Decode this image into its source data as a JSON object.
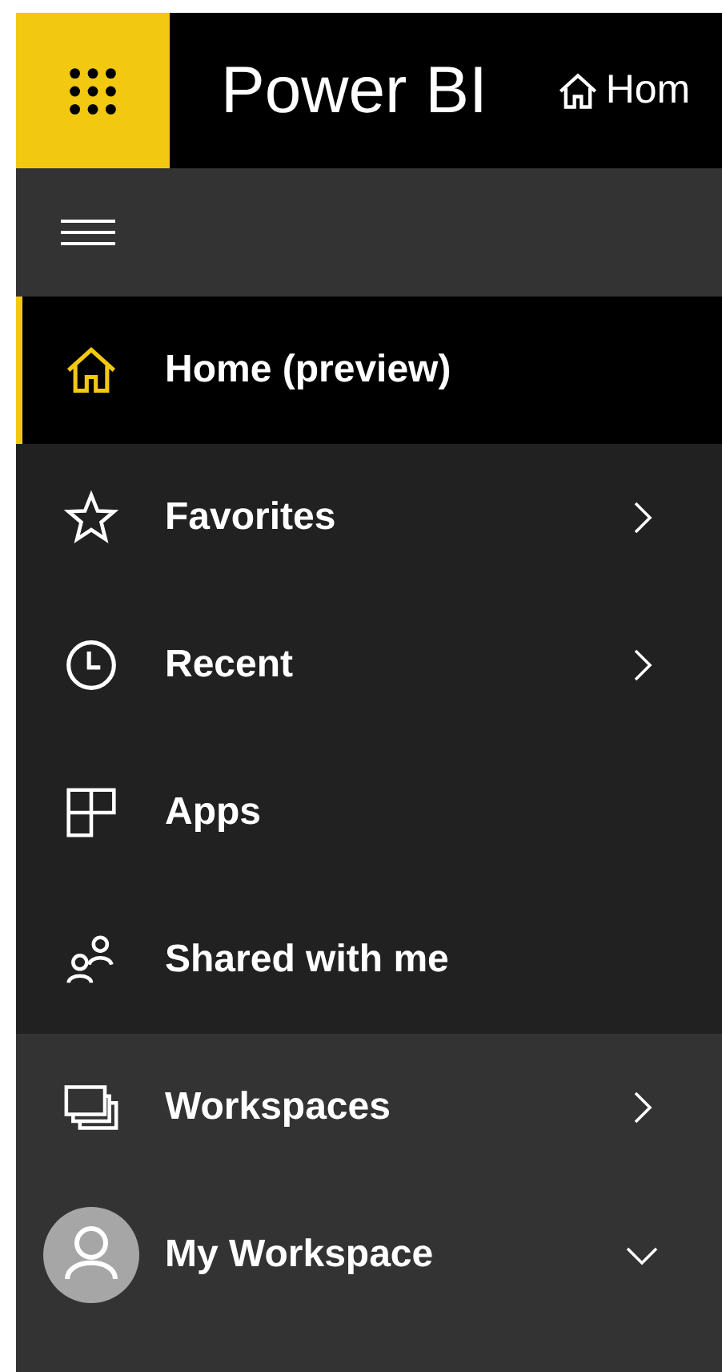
{
  "header": {
    "app_name": "Power BI",
    "breadcrumb": "Hom"
  },
  "nav": {
    "items": [
      {
        "label": "Home (preview)",
        "selected": true,
        "expandable": false
      },
      {
        "label": "Favorites",
        "selected": false,
        "expandable": true,
        "expanded": false
      },
      {
        "label": "Recent",
        "selected": false,
        "expandable": true,
        "expanded": false
      },
      {
        "label": "Apps",
        "selected": false,
        "expandable": false
      },
      {
        "label": "Shared with me",
        "selected": false,
        "expandable": false
      }
    ]
  },
  "workspaces": {
    "items": [
      {
        "label": "Workspaces",
        "selected": false,
        "expandable": true,
        "expanded": false
      },
      {
        "label": "My Workspace",
        "selected": false,
        "expandable": true,
        "expanded": true
      }
    ]
  }
}
